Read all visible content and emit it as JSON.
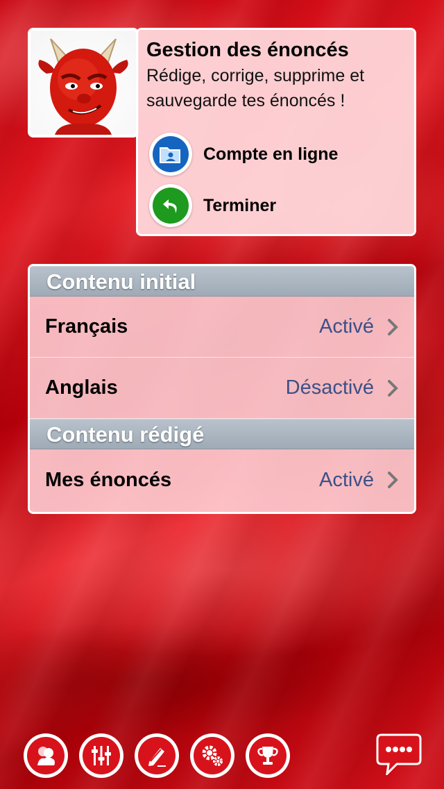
{
  "header": {
    "title": "Gestion des énoncés",
    "description": "Rédige, corrige, supprime et sauvegarde tes énoncés !",
    "actions": [
      {
        "label": "Compte en ligne",
        "icon": "account-folder-icon",
        "color": "#1565c0"
      },
      {
        "label": "Terminer",
        "icon": "back-arrow-icon",
        "color": "#1e9a1e"
      }
    ]
  },
  "sections": [
    {
      "title": "Contenu initial",
      "rows": [
        {
          "label": "Français",
          "value": "Activé"
        },
        {
          "label": "Anglais",
          "value": "Désactivé"
        }
      ]
    },
    {
      "title": "Contenu rédigé",
      "rows": [
        {
          "label": "Mes énoncés",
          "value": "Activé"
        }
      ]
    }
  ],
  "toolbar": {
    "buttons": [
      {
        "icon": "users-icon"
      },
      {
        "icon": "sliders-icon"
      },
      {
        "icon": "pencil-icon"
      },
      {
        "icon": "gears-icon"
      },
      {
        "icon": "trophy-icon"
      }
    ],
    "chat_icon": "chat-bubble-icon"
  },
  "colors": {
    "accent": "#d8121b",
    "value_text": "#3c5088",
    "section_header": "#a8b3be"
  }
}
